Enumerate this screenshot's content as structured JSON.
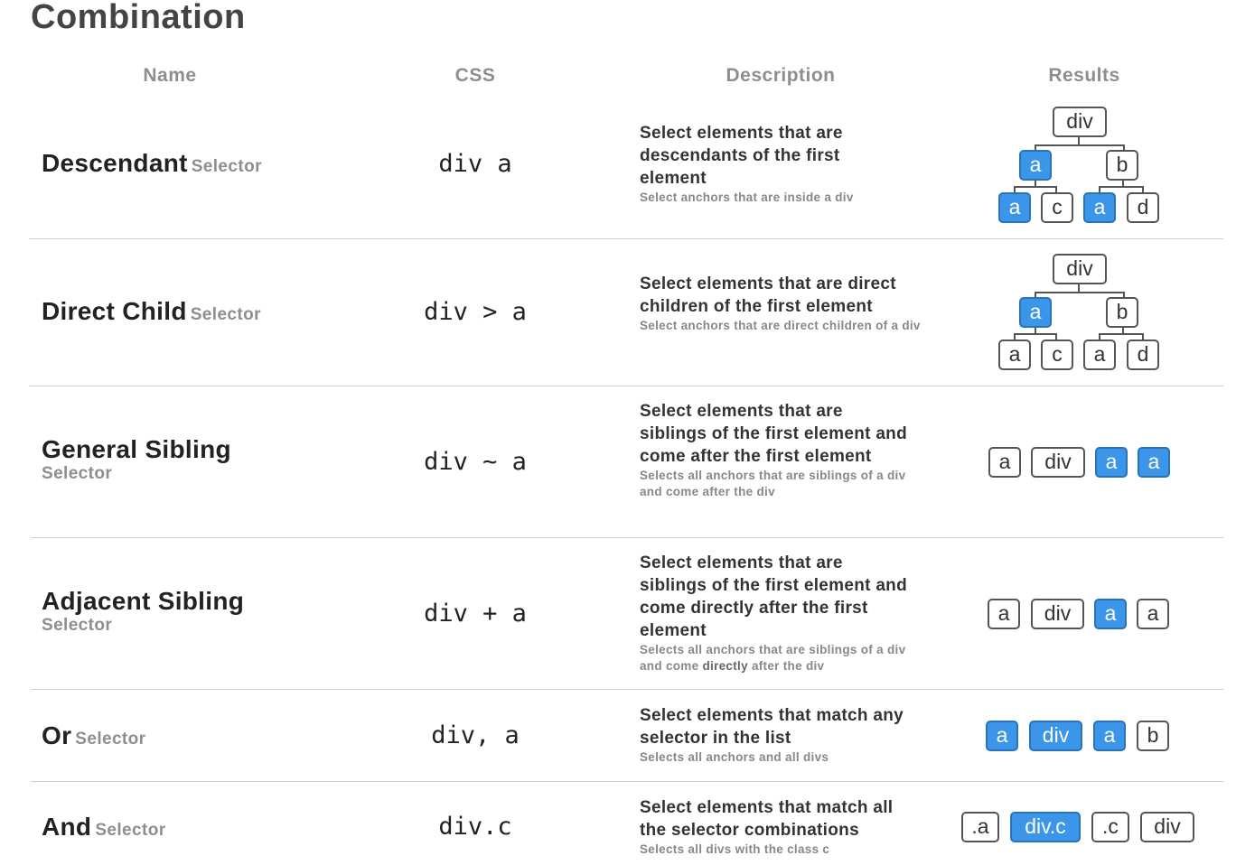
{
  "title": "Combination",
  "headers": {
    "name": "Name",
    "css": "CSS",
    "description": "Description",
    "results": "Results"
  },
  "rows": [
    {
      "name": "Descendant",
      "sub": "Selector",
      "css": "div a",
      "description": "Select elements that are descendants of the first element",
      "example": "Select anchors that are inside a div",
      "result_type": "tree",
      "tree": {
        "root": "div",
        "left": "a",
        "right": "b",
        "leaves": [
          "a",
          "c",
          "a",
          "d"
        ]
      },
      "highlighted": [
        "left",
        "leaf0",
        "leaf2"
      ]
    },
    {
      "name": "Direct Child",
      "sub": "Selector",
      "css": "div > a",
      "description": "Select elements that are direct children of the first element",
      "example": "Select anchors that are direct children of a div",
      "result_type": "tree",
      "tree": {
        "root": "div",
        "left": "a",
        "right": "b",
        "leaves": [
          "a",
          "c",
          "a",
          "d"
        ]
      },
      "highlighted": [
        "left"
      ]
    },
    {
      "name": "General Sibling",
      "sub": "Selector",
      "css": "div ~ a",
      "description": "Select elements that are siblings of the first element and come after the first element",
      "example": "Selects all anchors that are siblings of a div and come after the div",
      "result_type": "list",
      "items": [
        {
          "label": "a",
          "highlighted": false
        },
        {
          "label": "div",
          "highlighted": false
        },
        {
          "label": "a",
          "highlighted": true
        },
        {
          "label": "a",
          "highlighted": true
        }
      ]
    },
    {
      "name": "Adjacent Sibling",
      "sub": "Selector",
      "css": "div + a",
      "description_pre": "Select elements that are siblings of the first element and come ",
      "description_bold": "directly",
      "description_post": " after the first element",
      "example_pre": "Selects all anchors that are siblings of a div and come ",
      "example_bold": "directly",
      "example_post": " after the div",
      "result_type": "list",
      "items": [
        {
          "label": "a",
          "highlighted": false
        },
        {
          "label": "div",
          "highlighted": false
        },
        {
          "label": "a",
          "highlighted": true
        },
        {
          "label": "a",
          "highlighted": false
        }
      ]
    },
    {
      "name": "Or",
      "sub": "Selector",
      "css": "div, a",
      "description": "Select elements that match any selector in the list",
      "example": "Selects all anchors and all divs",
      "result_type": "list",
      "items": [
        {
          "label": "a",
          "highlighted": true
        },
        {
          "label": "div",
          "highlighted": true
        },
        {
          "label": "a",
          "highlighted": true
        },
        {
          "label": "b",
          "highlighted": false
        }
      ]
    },
    {
      "name": "And",
      "sub": "Selector",
      "css": "div.c",
      "description": "Select elements that match all the selector combinations",
      "example": "Selects all divs with the class c",
      "result_type": "list",
      "items": [
        {
          "label": ".a",
          "highlighted": false
        },
        {
          "label": "div.c",
          "highlighted": true
        },
        {
          "label": ".c",
          "highlighted": false
        },
        {
          "label": "div",
          "highlighted": false
        }
      ]
    }
  ],
  "colors": {
    "highlight": "#3b95e8",
    "header": "#8e8e8e",
    "text": "#222222"
  }
}
